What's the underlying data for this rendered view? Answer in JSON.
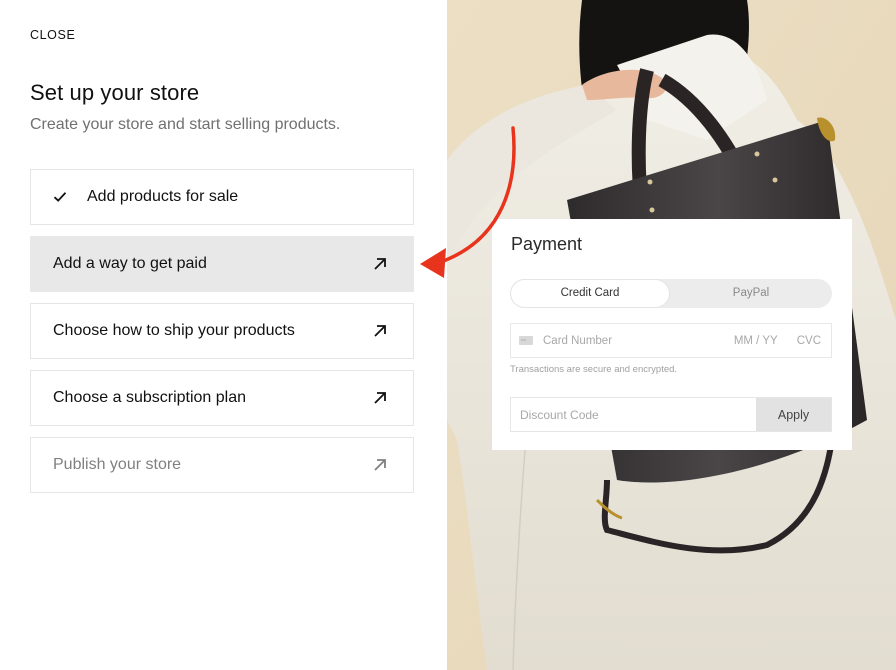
{
  "panel": {
    "close_label": "CLOSE",
    "title": "Set up your store",
    "subtitle": "Create your store and start selling products.",
    "steps": [
      {
        "label": "Add products for sale",
        "state": "completed",
        "icon": "check-icon"
      },
      {
        "label": "Add a way to get paid",
        "state": "active",
        "icon": "arrow-up-right-icon"
      },
      {
        "label": "Choose how to ship your products",
        "state": "pending",
        "icon": "arrow-up-right-icon"
      },
      {
        "label": "Choose a subscription plan",
        "state": "pending",
        "icon": "arrow-up-right-icon"
      },
      {
        "label": "Publish your store",
        "state": "disabled",
        "icon": "arrow-up-right-icon"
      }
    ]
  },
  "payment": {
    "title": "Payment",
    "methods": [
      {
        "label": "Credit Card",
        "selected": true
      },
      {
        "label": "PayPal",
        "selected": false
      }
    ],
    "card_field": {
      "icon": "credit-card-icon",
      "number_placeholder": "Card Number",
      "expiry_placeholder": "MM / YY",
      "cvc_placeholder": "CVC"
    },
    "security_note": "Transactions are secure and encrypted.",
    "discount_placeholder": "Discount Code",
    "apply_label": "Apply"
  },
  "colors": {
    "accent_arrow": "#e8341c",
    "active_step_bg": "#e8e8e8",
    "photo_bg": "#eadcc0"
  }
}
